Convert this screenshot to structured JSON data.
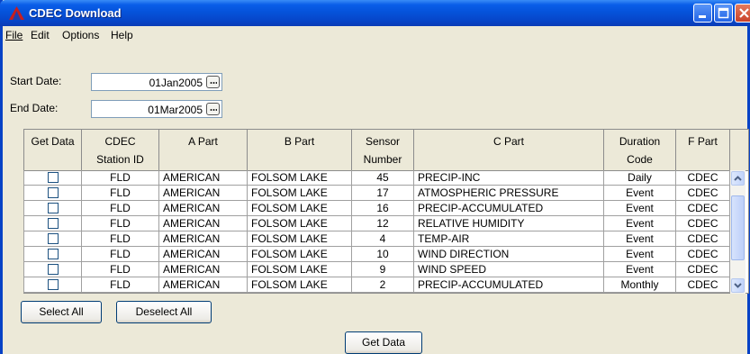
{
  "window": {
    "title": "CDEC Download"
  },
  "menu": {
    "file": "File",
    "edit": "Edit",
    "options": "Options",
    "help": "Help"
  },
  "form": {
    "start_label": "Start Date:",
    "start_value": "01Jan2005",
    "end_label": "End Date:",
    "end_value": "01Mar2005"
  },
  "table": {
    "headers": [
      [
        "Get Data",
        ""
      ],
      [
        "CDEC",
        "Station ID"
      ],
      [
        "A Part",
        ""
      ],
      [
        "B Part",
        ""
      ],
      [
        "Sensor",
        "Number"
      ],
      [
        "C Part",
        ""
      ],
      [
        "Duration",
        "Code"
      ],
      [
        "F Part",
        ""
      ]
    ],
    "rows": [
      {
        "checked": false,
        "station": "FLD",
        "a": "AMERICAN",
        "b": "FOLSOM LAKE",
        "sensor": "45",
        "c": "PRECIP-INC",
        "duration": "Daily",
        "f": "CDEC"
      },
      {
        "checked": false,
        "station": "FLD",
        "a": "AMERICAN",
        "b": "FOLSOM LAKE",
        "sensor": "17",
        "c": "ATMOSPHERIC PRESSURE",
        "duration": "Event",
        "f": "CDEC"
      },
      {
        "checked": false,
        "station": "FLD",
        "a": "AMERICAN",
        "b": "FOLSOM LAKE",
        "sensor": "16",
        "c": "PRECIP-ACCUMULATED",
        "duration": "Event",
        "f": "CDEC"
      },
      {
        "checked": false,
        "station": "FLD",
        "a": "AMERICAN",
        "b": "FOLSOM LAKE",
        "sensor": "12",
        "c": "RELATIVE HUMIDITY",
        "duration": "Event",
        "f": "CDEC"
      },
      {
        "checked": false,
        "station": "FLD",
        "a": "AMERICAN",
        "b": "FOLSOM LAKE",
        "sensor": "4",
        "c": "TEMP-AIR",
        "duration": "Event",
        "f": "CDEC"
      },
      {
        "checked": false,
        "station": "FLD",
        "a": "AMERICAN",
        "b": "FOLSOM LAKE",
        "sensor": "10",
        "c": "WIND DIRECTION",
        "duration": "Event",
        "f": "CDEC"
      },
      {
        "checked": false,
        "station": "FLD",
        "a": "AMERICAN",
        "b": "FOLSOM LAKE",
        "sensor": "9",
        "c": "WIND SPEED",
        "duration": "Event",
        "f": "CDEC"
      },
      {
        "checked": false,
        "station": "FLD",
        "a": "AMERICAN",
        "b": "FOLSOM LAKE",
        "sensor": "2",
        "c": "PRECIP-ACCUMULATED",
        "duration": "Monthly",
        "f": "CDEC"
      }
    ]
  },
  "buttons": {
    "select_all": "Select All",
    "deselect_all": "Deselect All",
    "get_data": "Get Data"
  },
  "colors": {
    "titlebar": "#0553db",
    "window_bg": "#ece9d8",
    "border": "#0842c6"
  }
}
